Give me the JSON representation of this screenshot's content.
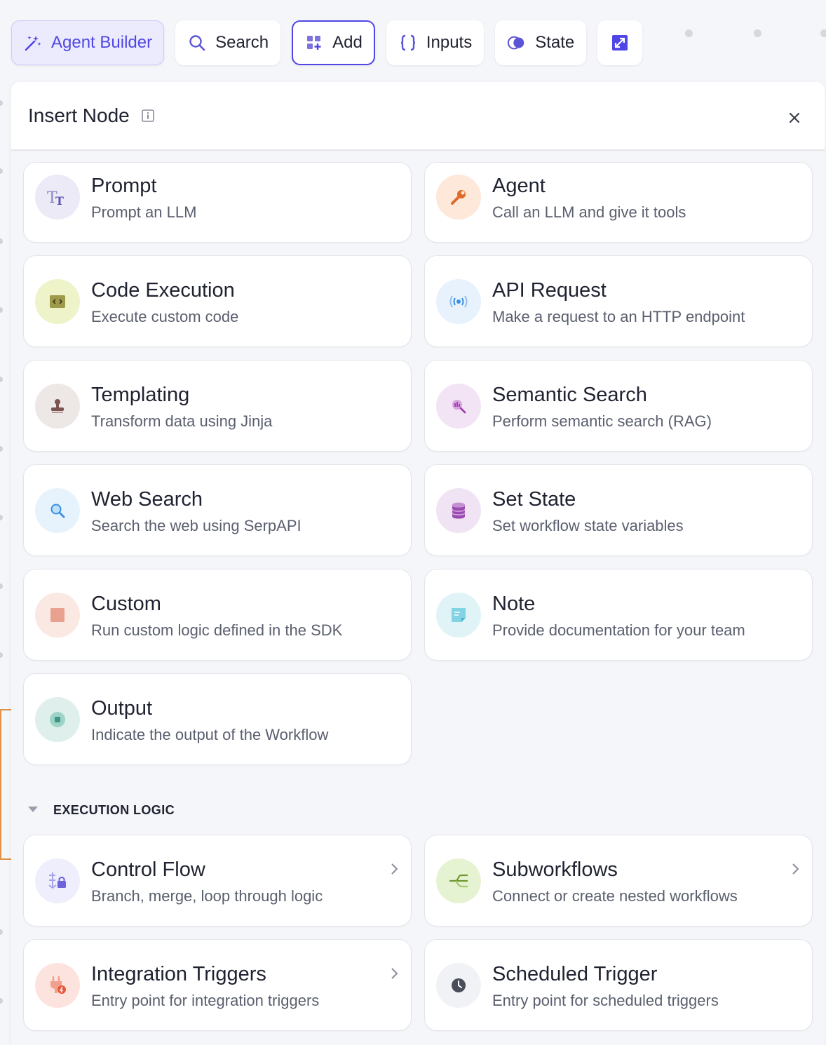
{
  "toolbar": {
    "agent_builder": "Agent Builder",
    "search": "Search",
    "add": "Add",
    "inputs": "Inputs",
    "state": "State",
    "icons": {
      "agent_builder": "wand-sparkle-icon",
      "search": "search-icon",
      "add": "add-grid-icon",
      "inputs": "braces-icon",
      "state": "state-toggle-icon",
      "expand": "expand-arrows-icon"
    }
  },
  "panel": {
    "title": "Insert Node",
    "info_icon": "info-icon",
    "close_icon": "close-icon"
  },
  "nodes": [
    {
      "name": "Prompt",
      "desc": "Prompt an LLM",
      "icon": "text-format-icon",
      "bg": "#ebeaf6",
      "color": "#6b66b8"
    },
    {
      "name": "Agent",
      "desc": "Call an LLM and give it tools",
      "icon": "wrench-icon",
      "bg": "#fde8da",
      "color": "#e06a2c"
    },
    {
      "name": "Code Execution",
      "desc": "Execute custom code",
      "icon": "code-icon",
      "bg": "#eef3c9",
      "color": "#8a8a2c"
    },
    {
      "name": "API Request",
      "desc": "Make a request to an HTTP endpoint",
      "icon": "broadcast-icon",
      "bg": "#e7f2fd",
      "color": "#3b8fe0"
    },
    {
      "name": "Templating",
      "desc": "Transform data using Jinja",
      "icon": "stamp-icon",
      "bg": "#ede7e6",
      "color": "#7a5350"
    },
    {
      "name": "Semantic Search",
      "desc": "Perform semantic search (RAG)",
      "icon": "search-chart-icon",
      "bg": "#f2e4f4",
      "color": "#a13fb2"
    },
    {
      "name": "Web Search",
      "desc": "Search the web using SerpAPI",
      "icon": "magnifier-icon",
      "bg": "#e6f3fd",
      "color": "#3b8fe0"
    },
    {
      "name": "Set State",
      "desc": "Set workflow state variables",
      "icon": "database-icon",
      "bg": "#f0e3f3",
      "color": "#9b4cb0"
    },
    {
      "name": "Custom",
      "desc": "Run custom logic defined in the SDK",
      "icon": "square-icon",
      "bg": "#fae8e3",
      "color": "#e8a18f"
    },
    {
      "name": "Note",
      "desc": "Provide documentation for your team",
      "icon": "sticky-note-icon",
      "bg": "#e0f4f7",
      "color": "#5fc7dc"
    },
    {
      "name": "Output",
      "desc": "Indicate the output of the Workflow",
      "icon": "stop-circle-icon",
      "bg": "#dff0ec",
      "color": "#3f9484"
    }
  ],
  "execution_logic": {
    "title": "EXECUTION LOGIC",
    "toggle_icon": "caret-down-icon",
    "items": [
      {
        "name": "Control Flow",
        "desc": "Branch, merge, loop through logic",
        "icon": "branch-lock-icon",
        "bg": "#eeeefc",
        "color": "#7b73de",
        "chevron": true
      },
      {
        "name": "Subworkflows",
        "desc": "Connect or create nested workflows",
        "icon": "subflow-icon",
        "bg": "#e6f3d3",
        "color": "#6e9a2f",
        "chevron": true
      },
      {
        "name": "Integration Triggers",
        "desc": "Entry point for integration triggers",
        "icon": "plug-icon",
        "bg": "#fde3dd",
        "color": "#e8573a",
        "chevron": true
      },
      {
        "name": "Scheduled Trigger",
        "desc": "Entry point for scheduled triggers",
        "icon": "clock-icon",
        "bg": "#f1f2f5",
        "color": "#4a4e5c",
        "chevron": false
      }
    ]
  },
  "colors": {
    "accent": "#4f46e5",
    "accent_bg": "#ecebfd",
    "background": "#f5f6f9",
    "card": "#ffffff"
  }
}
